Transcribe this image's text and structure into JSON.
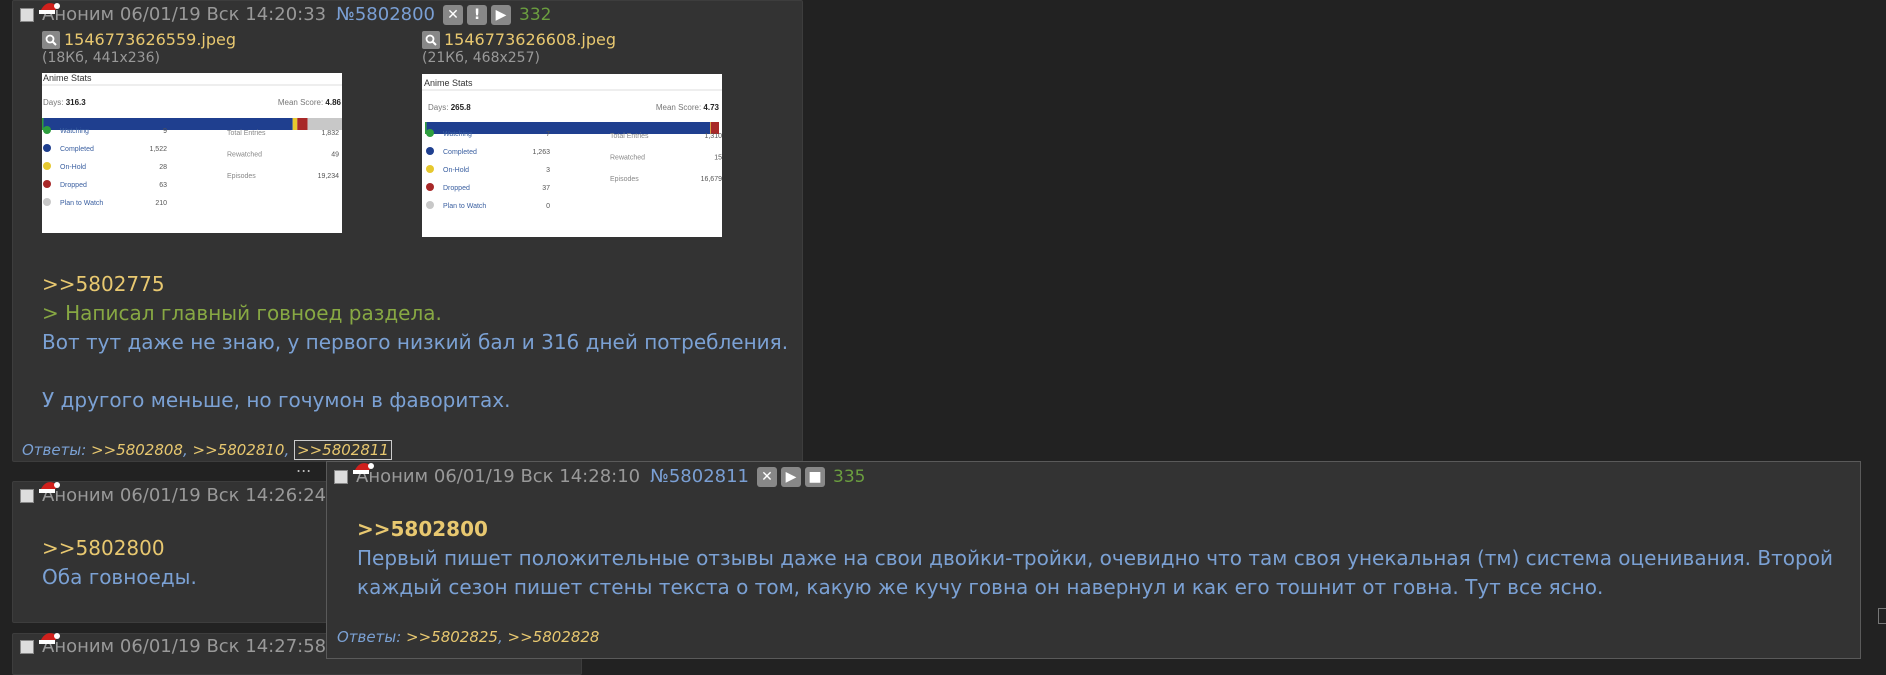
{
  "post1": {
    "author": "Аноним",
    "datetime": "06/01/19 Вск 14:20:33",
    "number": "№5802800",
    "count": "332",
    "file1": {
      "name": "1546773626559.jpeg",
      "info": "(18Кб, 441x236)"
    },
    "file2": {
      "name": "1546773626608.jpeg",
      "info": "(21Кб, 468x257)"
    },
    "reply_link": ">>5802775",
    "quote": "> Написал главный говноед раздела.",
    "line1": "Вот тут даже не знаю, у первого низкий бал и 316 дней потребления.",
    "line2": "У другого меньше, но гочумон в фаворитах.",
    "replies_label": "Ответы:",
    "replies": [
      ">>5802808",
      ">>5802810",
      ">>5802811"
    ]
  },
  "thumb1": {
    "title": "Anime Stats",
    "days_label": "Days:",
    "days": "316.3",
    "mean_label": "Mean Score:",
    "mean": "4.86",
    "stats": [
      {
        "label": "Watching",
        "value": "9",
        "color": "#2e9e3e"
      },
      {
        "label": "Completed",
        "value": "1,522",
        "color": "#1f3f8f"
      },
      {
        "label": "On-Hold",
        "value": "28",
        "color": "#e6c82e"
      },
      {
        "label": "Dropped",
        "value": "63",
        "color": "#a82828"
      },
      {
        "label": "Plan to Watch",
        "value": "210",
        "color": "#c8c8c8"
      }
    ],
    "totals": [
      {
        "label": "Total Entries",
        "value": "1,832"
      },
      {
        "label": "Rewatched",
        "value": "49"
      },
      {
        "label": "Episodes",
        "value": "19,234"
      }
    ]
  },
  "thumb2": {
    "title": "Anime Stats",
    "days_label": "Days:",
    "days": "265.8",
    "mean_label": "Mean Score:",
    "mean": "4.73",
    "stats": [
      {
        "label": "Watching",
        "value": "7",
        "color": "#2e9e3e"
      },
      {
        "label": "Completed",
        "value": "1,263",
        "color": "#1f3f8f"
      },
      {
        "label": "On-Hold",
        "value": "3",
        "color": "#e6c82e"
      },
      {
        "label": "Dropped",
        "value": "37",
        "color": "#a82828"
      },
      {
        "label": "Plan to Watch",
        "value": "0",
        "color": "#c8c8c8"
      }
    ],
    "totals": [
      {
        "label": "Total Entries",
        "value": "1,310"
      },
      {
        "label": "Rewatched",
        "value": "15"
      },
      {
        "label": "Episodes",
        "value": "16,679"
      }
    ]
  },
  "post2": {
    "author": "Аноним",
    "datetime": "06/01/19 Вск 14:26:24",
    "reply_link": ">>5802800",
    "line1": "Оба говноеды.",
    "ellipsis": "..."
  },
  "post3": {
    "author": "Аноним",
    "datetime": "06/01/19 Вск 14:27:58"
  },
  "popup": {
    "author": "Аноним",
    "datetime": "06/01/19 Вск 14:28:10",
    "number": "№5802811",
    "count": "335",
    "reply_link": ">>5802800",
    "line1": "Первый пишет положительные отзывы даже на свои двойки-тройки, очевидно что там своя унекальная (тм) система оценивания. Второй",
    "line2": "каждый сезон пишет стены текста о том, какую же кучу говна он навернул и как его тошнит от говна. Тут все ясно.",
    "replies_label": "Ответы:",
    "replies": [
      ">>5802825",
      ">>5802828"
    ]
  }
}
